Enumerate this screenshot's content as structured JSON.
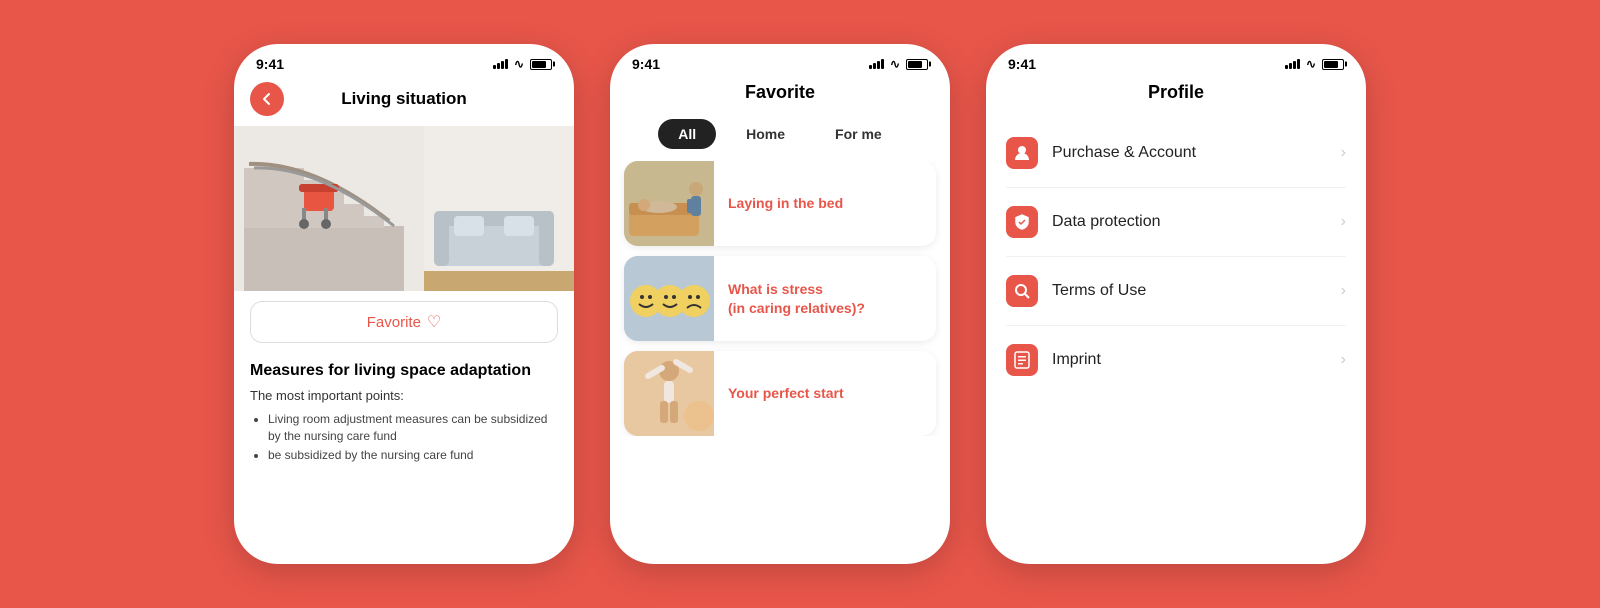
{
  "background": "#e8564a",
  "phone1": {
    "status": {
      "time": "9:41",
      "signal": true,
      "wifi": true,
      "battery": true
    },
    "nav": {
      "back_label": "back",
      "title": "Living situation"
    },
    "favorite": {
      "label": "Favorite"
    },
    "content": {
      "title": "Measures for living space adaptation",
      "subtitle": "The most important points:",
      "bullets": [
        "Living room adjustment measures can be subsidized by the nursing care fund",
        "be subsidized by the nursing care fund"
      ]
    }
  },
  "phone2": {
    "status": {
      "time": "9:41"
    },
    "title": "Favorite",
    "filters": [
      {
        "label": "All",
        "active": true
      },
      {
        "label": "Home",
        "active": false
      },
      {
        "label": "For me",
        "active": false
      }
    ],
    "cards": [
      {
        "title": "Laying in the bed",
        "thumb": "thumb-1"
      },
      {
        "title": "What is stress\n(in caring relatives)?",
        "thumb": "thumb-2"
      },
      {
        "title": "Your perfect start",
        "thumb": "thumb-3"
      }
    ]
  },
  "phone3": {
    "status": {
      "time": "9:41"
    },
    "title": "Profile",
    "menu_items": [
      {
        "label": "Purchase & Account",
        "icon": "person"
      },
      {
        "label": "Data protection",
        "icon": "shield"
      },
      {
        "label": "Terms of Use",
        "icon": "search-shield"
      },
      {
        "label": "Imprint",
        "icon": "doc"
      }
    ]
  }
}
